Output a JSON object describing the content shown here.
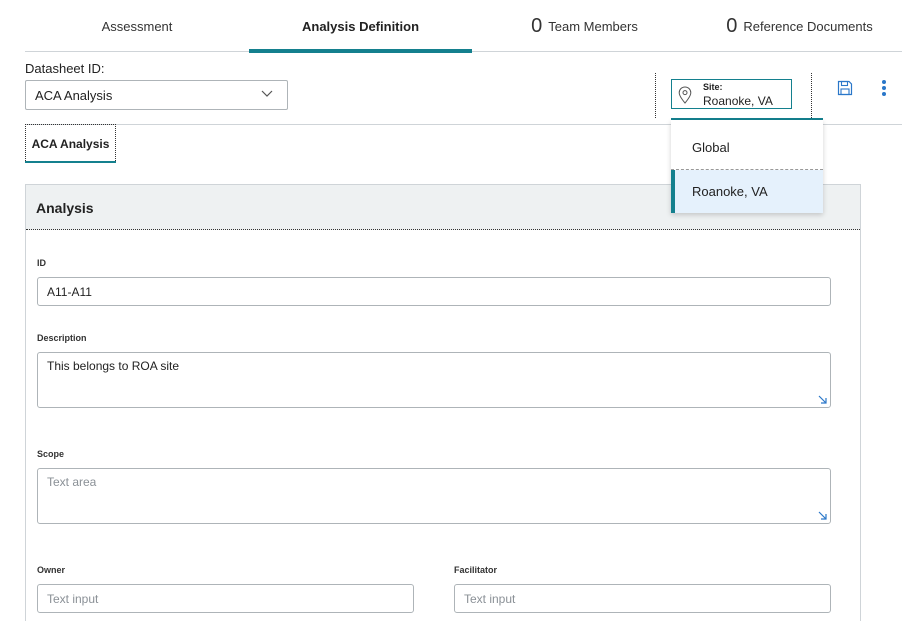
{
  "tabs": [
    {
      "label": "Assessment",
      "count": ""
    },
    {
      "label": "Analysis Definition",
      "count": ""
    },
    {
      "label": "Team Members",
      "count": "0"
    },
    {
      "label": "Reference Documents",
      "count": "0"
    }
  ],
  "datasheet": {
    "label": "Datasheet ID:",
    "selected": "ACA Analysis"
  },
  "site": {
    "label": "Site:",
    "value": "Roanoke, VA",
    "options": [
      "Global",
      "Roanoke, VA"
    ]
  },
  "subtab": {
    "label": "ACA Analysis"
  },
  "panel": {
    "title": "Analysis",
    "fields": {
      "id": {
        "label": "ID",
        "value": "A11-A11"
      },
      "description": {
        "label": "Description",
        "value": "This belongs to ROA site"
      },
      "scope": {
        "label": "Scope",
        "placeholder": "Text area"
      },
      "owner": {
        "label": "Owner",
        "placeholder": "Text input"
      },
      "facilitator": {
        "label": "Facilitator",
        "placeholder": "Text input"
      }
    }
  },
  "colors": {
    "accent": "#14808e",
    "icon": "#2a77c9",
    "selected_bg": "#e5f1fc"
  }
}
